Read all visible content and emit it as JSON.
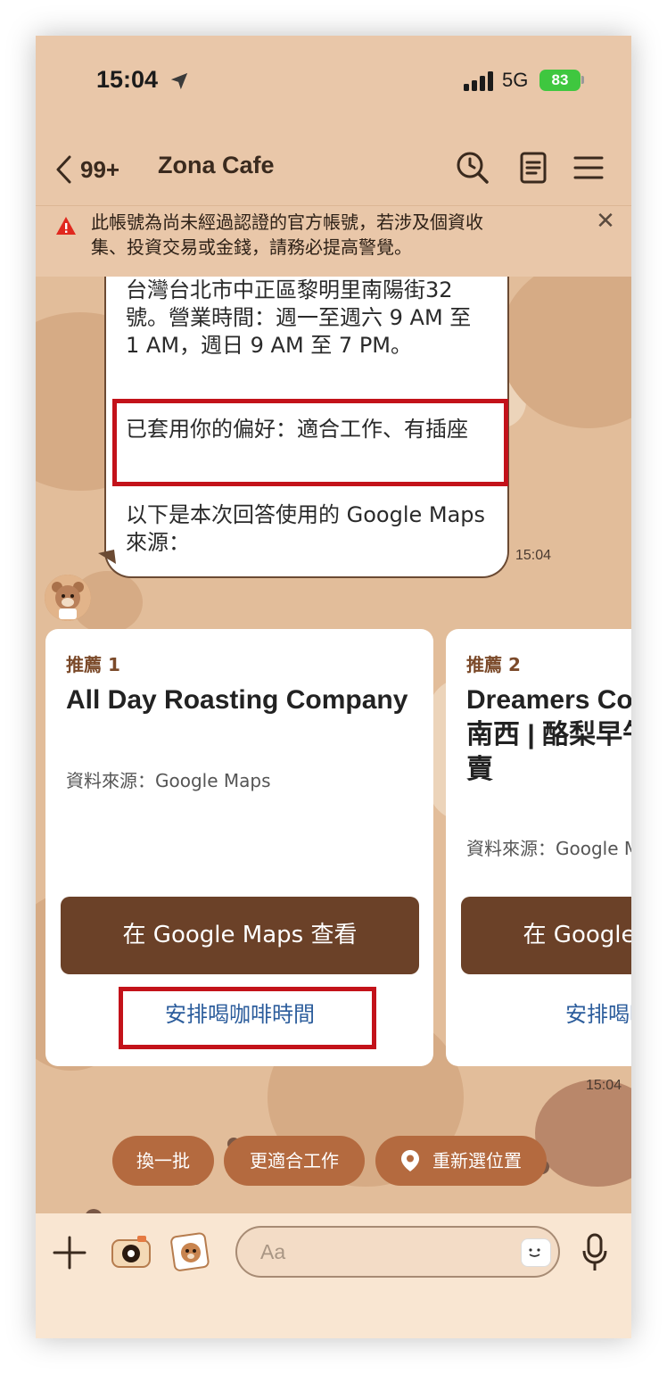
{
  "status": {
    "time": "15:04",
    "network": "5G",
    "battery": "83"
  },
  "header": {
    "back_count": "99+",
    "title": "Zona Cafe"
  },
  "warning": {
    "text": "此帳號為尚未經過認證的官方帳號，若涉及個資收集、投資交易或金錢，請務必提高警覺。"
  },
  "message": {
    "address_text": "台灣台北市中正區黎明里南陽街32號。營業時間：週一至週六 9 AM 至 1 AM，週日 9 AM 至 7 PM。",
    "preference_text": "已套用你的偏好：適合工作、有插座",
    "sources_text": "以下是本次回答使用的 Google Maps 來源：",
    "time": "15:04"
  },
  "cards": [
    {
      "label": "推薦 1",
      "name": "All Day Roasting Company",
      "source": "資料來源：Google Maps",
      "maps_button": "在 Google Maps 查看",
      "schedule_link": "安排喝咖啡時間"
    },
    {
      "label": "推薦 2",
      "name": "Dreamers Coffee Roasters 南西 | 酪梨早午餐 x 咖啡專賣",
      "source": "資料來源：Google Maps",
      "maps_button": "在 Google Maps 查看",
      "schedule_link": "安排喝咖啡時間"
    }
  ],
  "cards_time": "15:04",
  "quick_replies": [
    "換一批",
    "更適合工作",
    "重新選位置"
  ],
  "input": {
    "placeholder": "Aa"
  },
  "colors": {
    "accent_brown": "#6b4128",
    "chip": "#b46a3f",
    "highlight": "#c3121a",
    "link": "#2c5d9c"
  }
}
